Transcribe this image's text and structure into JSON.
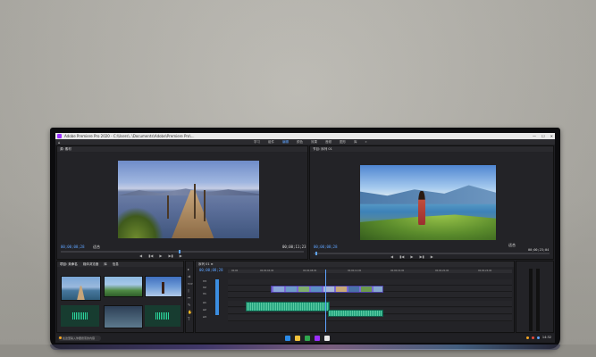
{
  "titlebar": {
    "title": "Adobe Premiere Pro 2020 - C:\\Users\\..\\Documents\\Adobe\\Premiere Pro\\...",
    "min": "—",
    "max": "☐",
    "close": "✕"
  },
  "menubar": {
    "home": "⌂",
    "workspaces": [
      "学习",
      "组件",
      "编辑",
      "颜色",
      "效果",
      "音频",
      "图形",
      "库",
      "»"
    ]
  },
  "source": {
    "header": "源: 素材",
    "tc_left": "00;00;08;28",
    "fit": "适合",
    "tc_right": "00;00;11;23"
  },
  "program": {
    "header": "节目: 序列 01",
    "tc_left": "00;00;08;28",
    "fit": "适合",
    "tc_right": "00;00;23;04"
  },
  "project": {
    "tabs": [
      "项目: 未命名",
      "媒体浏览器",
      "库",
      "信息"
    ],
    "thumbs": [
      "DJI_0001.MP4",
      "DJI_0002.MP4",
      "DJI_0003.MP4",
      "DJI_0004.MP4",
      "DJI_0005.MP4"
    ]
  },
  "timeline": {
    "header": "序列 01 ≡",
    "tc": "00;00;08;28",
    "ruler": [
      "00;00",
      "00;00;04;00",
      "00;00;08;00",
      "00;00;12;00",
      "00;00;16;00",
      "00;00;20;00",
      "00;00;24;00"
    ],
    "tracks": [
      "V3",
      "V2",
      "V1",
      "A1",
      "A2",
      "A3"
    ]
  },
  "taskbar": {
    "search_placeholder": "在这里输入你要搜索的内容",
    "time": "14:32"
  },
  "icons": {
    "transport": [
      "◀",
      "▮◀",
      "◀",
      "▶",
      "▶▮",
      "▶"
    ]
  }
}
